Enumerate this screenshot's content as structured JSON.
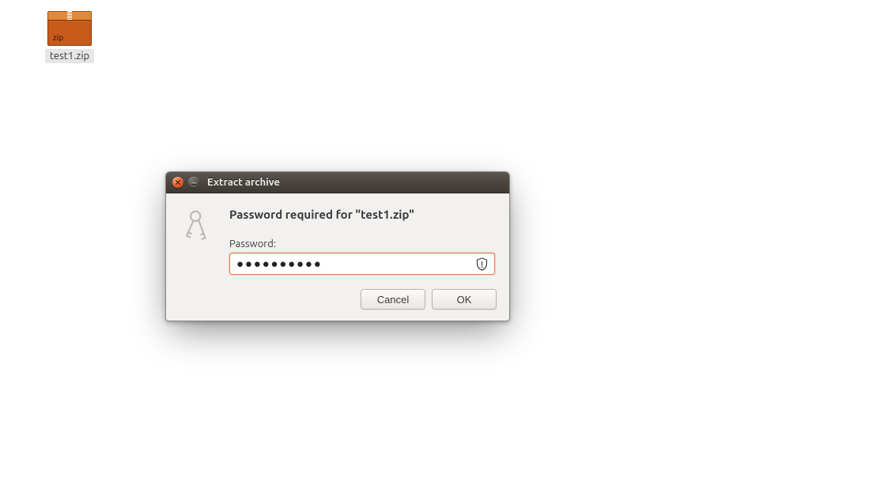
{
  "desktop": {
    "file": {
      "name": "test1.zip",
      "icon_name": "zip-archive-icon",
      "zip_badge_text": "zip"
    }
  },
  "dialog": {
    "window_title": "Extract archive",
    "icon_name": "keys-icon",
    "heading": "Password required for \"test1.zip\"",
    "password_label": "Password:",
    "password_value": "●●●●●●●●●●",
    "password_security_icon": "shield-warning-icon",
    "buttons": {
      "cancel": "Cancel",
      "ok": "OK"
    }
  },
  "colors": {
    "accent": "#e45b24",
    "dialog_bg": "#f2f1ef",
    "input_focus_border": "#df8a4f"
  }
}
